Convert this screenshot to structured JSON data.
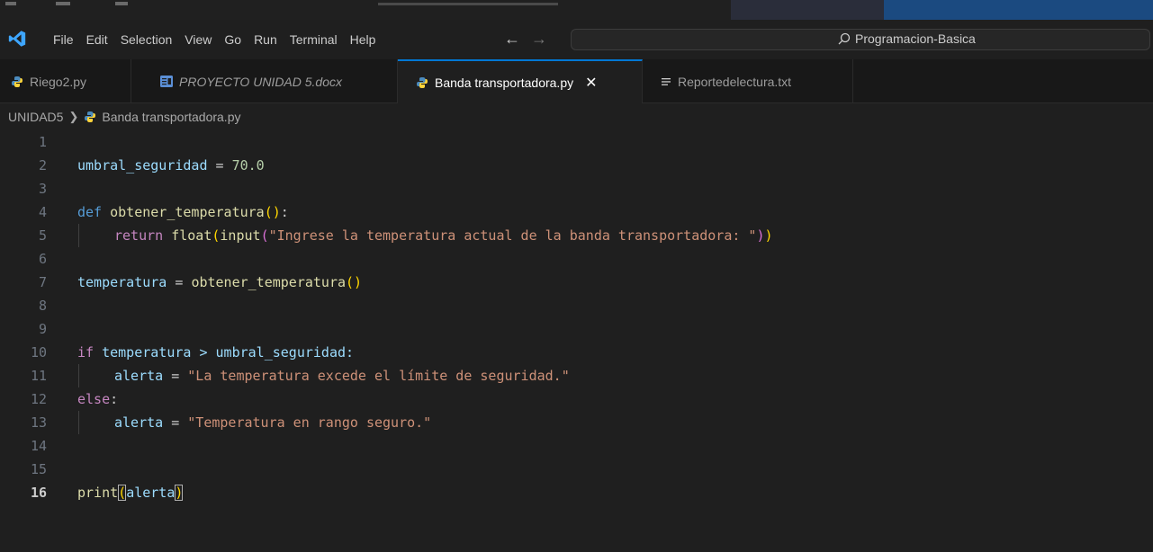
{
  "menu": {
    "items": [
      "File",
      "Edit",
      "Selection",
      "View",
      "Go",
      "Run",
      "Terminal",
      "Help"
    ]
  },
  "nav": {
    "back_icon": "arrow-left-icon",
    "forward_icon": "arrow-right-icon"
  },
  "search": {
    "text": "Programacion-Basica",
    "icon": "search-icon"
  },
  "tabs": [
    {
      "label": "Riego2.py",
      "icon": "python-file-icon"
    },
    {
      "label": "PROYECTO UNIDAD 5.docx",
      "icon": "word-doc-icon"
    },
    {
      "label": "Banda transportadora.py",
      "icon": "python-file-icon",
      "active": true
    },
    {
      "label": "Reportedelectura.txt",
      "icon": "text-file-icon"
    }
  ],
  "breadcrumb": {
    "folder": "UNIDAD5",
    "file": "Banda transportadora.py"
  },
  "editor": {
    "current_line": 16,
    "line_numbers": [
      "1",
      "2",
      "3",
      "4",
      "5",
      "6",
      "7",
      "8",
      "9",
      "10",
      "11",
      "12",
      "13",
      "14",
      "15",
      "16"
    ],
    "lines": {
      "l2": {
        "a": "umbral_seguridad",
        "b": " = ",
        "c": "70.0"
      },
      "l4": {
        "a": "def",
        "b": " ",
        "c": "obtener_temperatura",
        "d": "()",
        "e": ":"
      },
      "l5": {
        "a": "return",
        "b": " ",
        "c": "float",
        "d": "(",
        "e": "input",
        "f": "(",
        "g": "\"Ingrese la temperatura actual de la banda transportadora: \"",
        "h": ")",
        "i": ")"
      },
      "l7": {
        "a": "temperatura",
        "b": " = ",
        "c": "obtener_temperatura",
        "d": "()"
      },
      "l10": {
        "a": "if",
        "b": " temperatura > umbral_seguridad:"
      },
      "l11": {
        "a": "alerta",
        "b": " = ",
        "c": "\"La temperatura excede el límite de seguridad.\""
      },
      "l12": {
        "a": "else",
        "b": ":"
      },
      "l13": {
        "a": "alerta",
        "b": " = ",
        "c": "\"Temperatura en rango seguro.\""
      },
      "l16": {
        "a": "print",
        "b": "(",
        "c": "alerta",
        "d": ")"
      }
    }
  },
  "colors": {
    "background": "#1f1f1f",
    "accent": "#0078d4",
    "keyword": "#569cd6",
    "control": "#c586c0",
    "function": "#dcdcaa",
    "string": "#ce9178",
    "number": "#b5cea8",
    "bracket": "#ffd700"
  }
}
